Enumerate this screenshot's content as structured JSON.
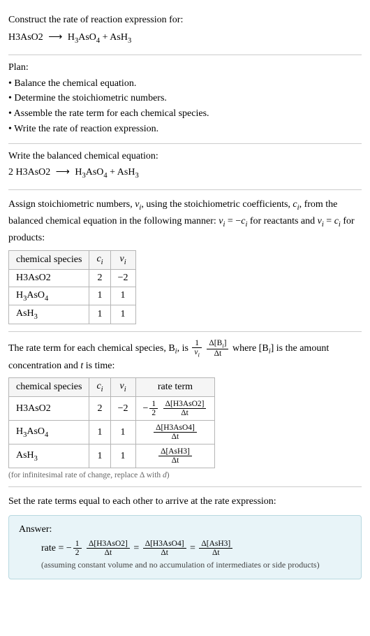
{
  "prompt": {
    "line1": "Construct the rate of reaction expression for:",
    "eq_lhs": "H3AsO2",
    "eq_arrow": "⟶",
    "eq_rhs1": "H",
    "eq_rhs1_sub1": "3",
    "eq_rhs1_mid": "AsO",
    "eq_rhs1_sub2": "4",
    "eq_plus": " + AsH",
    "eq_rhs2_sub": "3"
  },
  "plan": {
    "label": "Plan:",
    "items": [
      "Balance the chemical equation.",
      "Determine the stoichiometric numbers.",
      "Assemble the rate term for each chemical species.",
      "Write the rate of reaction expression."
    ]
  },
  "balanced": {
    "label": "Write the balanced chemical equation:",
    "coef": "2",
    "sp1": " H3AsO2",
    "arrow": "⟶",
    "sp2a": " H",
    "sp2sub1": "3",
    "sp2b": "AsO",
    "sp2sub2": "4",
    "plus": " + AsH",
    "sp3sub": "3"
  },
  "stoich": {
    "intro_a": "Assign stoichiometric numbers, ",
    "nu": "ν",
    "sub_i": "i",
    "intro_b": ", using the stoichiometric coefficients, ",
    "c": "c",
    "intro_c": ", from the balanced chemical equation in the following manner: ",
    "eq1": " = −",
    "intro_d": " for reactants and ",
    "eq2": " = ",
    "intro_e": " for products:",
    "headers": {
      "species": "chemical species",
      "c": "c",
      "nu": "ν"
    },
    "rows": [
      {
        "species": "H3AsO2",
        "c": "2",
        "nu": "−2",
        "has_sub": false
      },
      {
        "species_a": "H",
        "sub1": "3",
        "species_b": "AsO",
        "sub2": "4",
        "c": "1",
        "nu": "1",
        "has_sub": true
      },
      {
        "species_a": "AsH",
        "sub1": "3",
        "species_b": "",
        "sub2": "",
        "c": "1",
        "nu": "1",
        "has_sub": true
      }
    ]
  },
  "rate_term": {
    "intro_a": "The rate term for each chemical species, B",
    "sub_i": "i",
    "intro_b": ", is ",
    "frac1_num": "1",
    "frac1_den_a": "ν",
    "frac2_num_a": "Δ[B",
    "frac2_num_b": "]",
    "frac2_den": "Δt",
    "intro_c": " where [B",
    "intro_d": "] is the amount concentration and ",
    "t": "t",
    "intro_e": " is time:",
    "headers": {
      "species": "chemical species",
      "c": "c",
      "nu": "ν",
      "rate": "rate term"
    },
    "rows": [
      {
        "species": "H3AsO2",
        "c": "2",
        "nu": "−2",
        "neg": "−",
        "half_num": "1",
        "half_den": "2",
        "dnum": "Δ[H3AsO2]",
        "dden": "Δt",
        "has_half": true,
        "has_sub": false
      },
      {
        "species_a": "H",
        "sub1": "3",
        "species_b": "AsO",
        "sub2": "4",
        "c": "1",
        "nu": "1",
        "dnum": "Δ[H3AsO4]",
        "dden": "Δt",
        "has_half": false,
        "has_sub": true
      },
      {
        "species_a": "AsH",
        "sub1": "3",
        "species_b": "",
        "sub2": "",
        "c": "1",
        "nu": "1",
        "dnum": "Δ[AsH3]",
        "dden": "Δt",
        "has_half": false,
        "has_sub": true
      }
    ],
    "caption": "(for infinitesimal rate of change, replace Δ with ",
    "caption_d": "d",
    "caption_end": ")"
  },
  "final": {
    "intro": "Set the rate terms equal to each other to arrive at the rate expression:",
    "answer_label": "Answer:",
    "rate": "rate = −",
    "half_num": "1",
    "half_den": "2",
    "t1_num": "Δ[H3AsO2]",
    "t1_den": "Δt",
    "eq": " = ",
    "t2_num": "Δ[H3AsO4]",
    "t2_den": "Δt",
    "t3_num": "Δ[AsH3]",
    "t3_den": "Δt",
    "note": "(assuming constant volume and no accumulation of intermediates or side products)"
  }
}
